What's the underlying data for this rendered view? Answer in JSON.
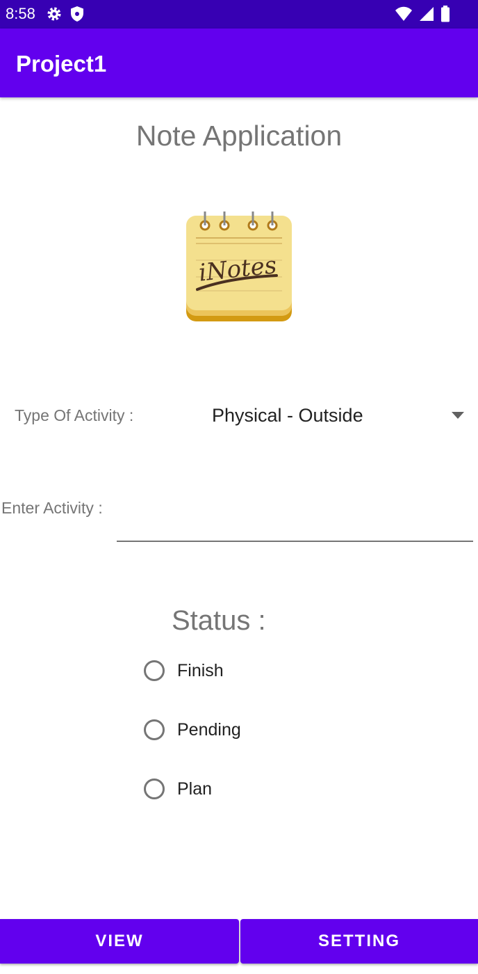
{
  "status_bar": {
    "time": "8:58",
    "icons_left": [
      "gear-icon",
      "shield-icon"
    ],
    "icons_right": [
      "wifi-icon",
      "signal-icon",
      "battery-icon"
    ]
  },
  "app_bar": {
    "title": "Project1"
  },
  "main": {
    "heading": "Note Application",
    "logo": {
      "icon": "notes-logo",
      "text": "iNotes"
    },
    "type_of_activity": {
      "label": "Type Of Activity :",
      "selected": "Physical - Outside"
    },
    "enter_activity": {
      "label": "Enter Activity :",
      "value": "",
      "placeholder": ""
    },
    "status": {
      "heading": "Status :",
      "options": [
        {
          "label": "Finish",
          "checked": false
        },
        {
          "label": "Pending",
          "checked": false
        },
        {
          "label": "Plan",
          "checked": false
        }
      ]
    }
  },
  "buttons": {
    "view": "VIEW",
    "setting": "SETTING"
  },
  "colors": {
    "status_bar": "#3700b3",
    "primary": "#6200ee",
    "label_gray": "#757575",
    "text_dark": "#212121"
  }
}
